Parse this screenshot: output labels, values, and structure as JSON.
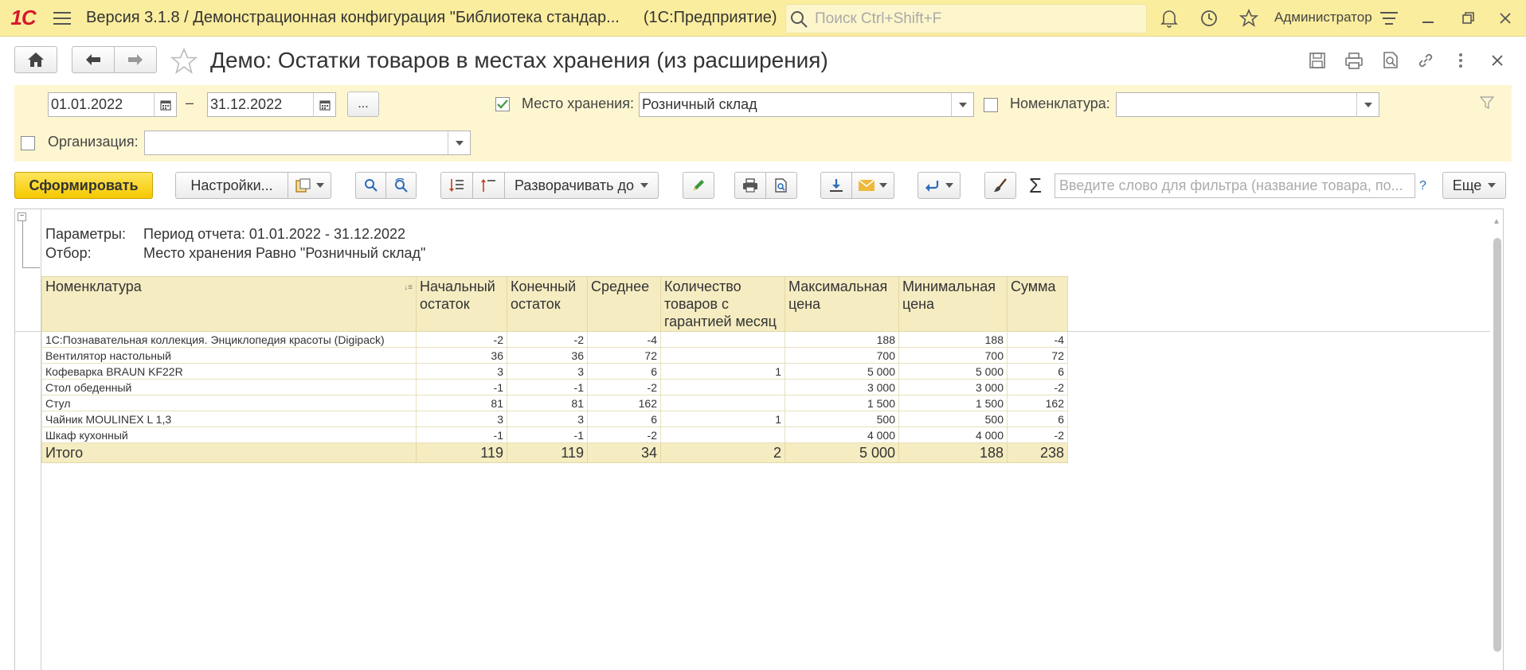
{
  "app": {
    "logo": "1С",
    "title": "Версия 3.1.8 / Демонстрационная конфигурация \"Библиотека стандар...",
    "platform": "(1С:Предприятие)",
    "search_placeholder": "Поиск Ctrl+Shift+F",
    "user": "Администратор"
  },
  "form": {
    "title": "Демо: Остатки товаров в местах хранения (из расширения)"
  },
  "filters": {
    "date_from": "01.01.2022",
    "date_sep": "–",
    "date_to": "31.12.2022",
    "period_button": "...",
    "storage_label": "Место хранения:",
    "storage_checked": true,
    "storage_value": "Розничный склад",
    "nomenclature_label": "Номенклатура:",
    "nomenclature_checked": false,
    "nomenclature_value": "",
    "organization_label": "Организация:",
    "organization_checked": false,
    "organization_value": ""
  },
  "toolbar": {
    "generate": "Сформировать",
    "settings": "Настройки...",
    "expand_to": "Разворачивать до",
    "filter_placeholder": "Введите слово для фильтра (название товара, по...",
    "help": "?",
    "more": "Еще"
  },
  "report": {
    "params_label": "Параметры:",
    "params_value": "Период отчета: 01.01.2022 - 31.12.2022",
    "filter_label": "Отбор:",
    "filter_value": "Место хранения Равно \"Розничный склад\"",
    "columns": [
      "Номенклатура",
      "Начальный остаток",
      "Конечный остаток",
      "Среднее",
      "Количество товаров с гарантией месяц",
      "Максимальная цена",
      "Минимальная цена",
      "Сумма"
    ],
    "rows": [
      [
        "1С:Познавательная коллекция. Энциклопедия красоты (Digipack)",
        "-2",
        "-2",
        "-4",
        "",
        "188",
        "188",
        "-4"
      ],
      [
        "Вентилятор настольный",
        "36",
        "36",
        "72",
        "",
        "700",
        "700",
        "72"
      ],
      [
        "Кофеварка BRAUN KF22R",
        "3",
        "3",
        "6",
        "1",
        "5 000",
        "5 000",
        "6"
      ],
      [
        "Стол обеденный",
        "-1",
        "-1",
        "-2",
        "",
        "3 000",
        "3 000",
        "-2"
      ],
      [
        "Стул",
        "81",
        "81",
        "162",
        "",
        "1 500",
        "1 500",
        "162"
      ],
      [
        "Чайник MOULINEX L 1,3",
        "3",
        "3",
        "6",
        "1",
        "500",
        "500",
        "6"
      ],
      [
        "Шкаф кухонный",
        "-1",
        "-1",
        "-2",
        "",
        "4 000",
        "4 000",
        "-2"
      ]
    ],
    "total": [
      "Итого",
      "119",
      "119",
      "34",
      "2",
      "5 000",
      "188",
      "238"
    ]
  },
  "colors": {
    "topbar": "#fbed9e",
    "filter_panel": "#fdf6d0",
    "primary_button": "#f5c900",
    "table_header": "#f5ecc2"
  }
}
